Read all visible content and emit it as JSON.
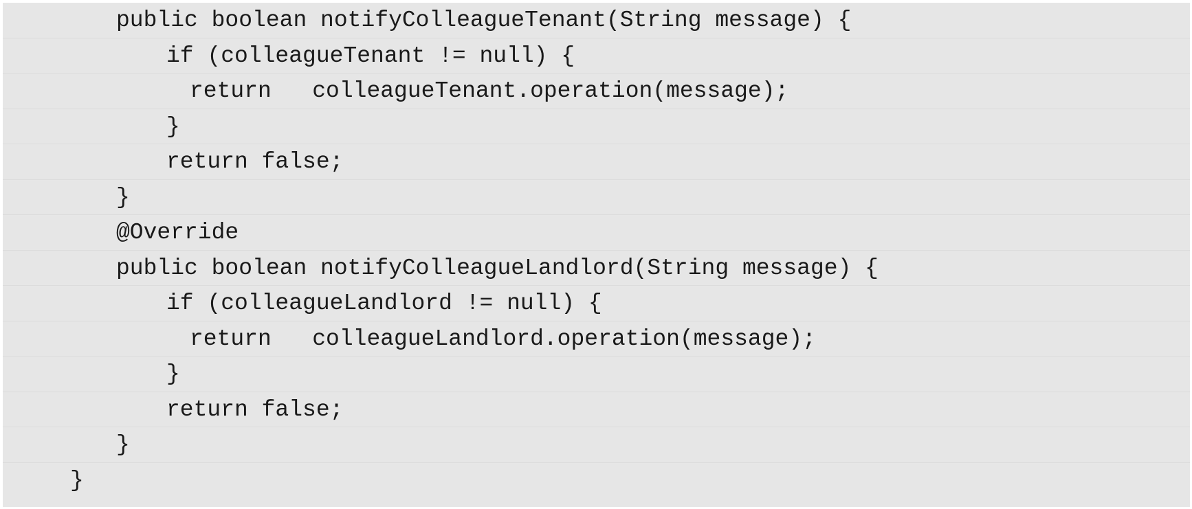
{
  "code": {
    "lines": [
      {
        "indent": 1,
        "text": "public boolean notifyColleagueTenant(String message) {"
      },
      {
        "indent": 2,
        "text": "if (colleagueTenant != null) {"
      },
      {
        "indent": 3,
        "text": "return   colleagueTenant.operation(message);"
      },
      {
        "indent": 2,
        "text": "}"
      },
      {
        "indent": 2,
        "text": "return false;"
      },
      {
        "indent": 1,
        "text": "}"
      },
      {
        "indent": 1,
        "text": "@Override"
      },
      {
        "indent": 1,
        "text": "public boolean notifyColleagueLandlord(String message) {"
      },
      {
        "indent": 2,
        "text": "if (colleagueLandlord != null) {"
      },
      {
        "indent": 3,
        "text": "return   colleagueLandlord.operation(message);"
      },
      {
        "indent": 2,
        "text": "}"
      },
      {
        "indent": 2,
        "text": "return false;"
      },
      {
        "indent": 1,
        "text": "}"
      },
      {
        "indent": 0,
        "text": "}"
      }
    ]
  }
}
